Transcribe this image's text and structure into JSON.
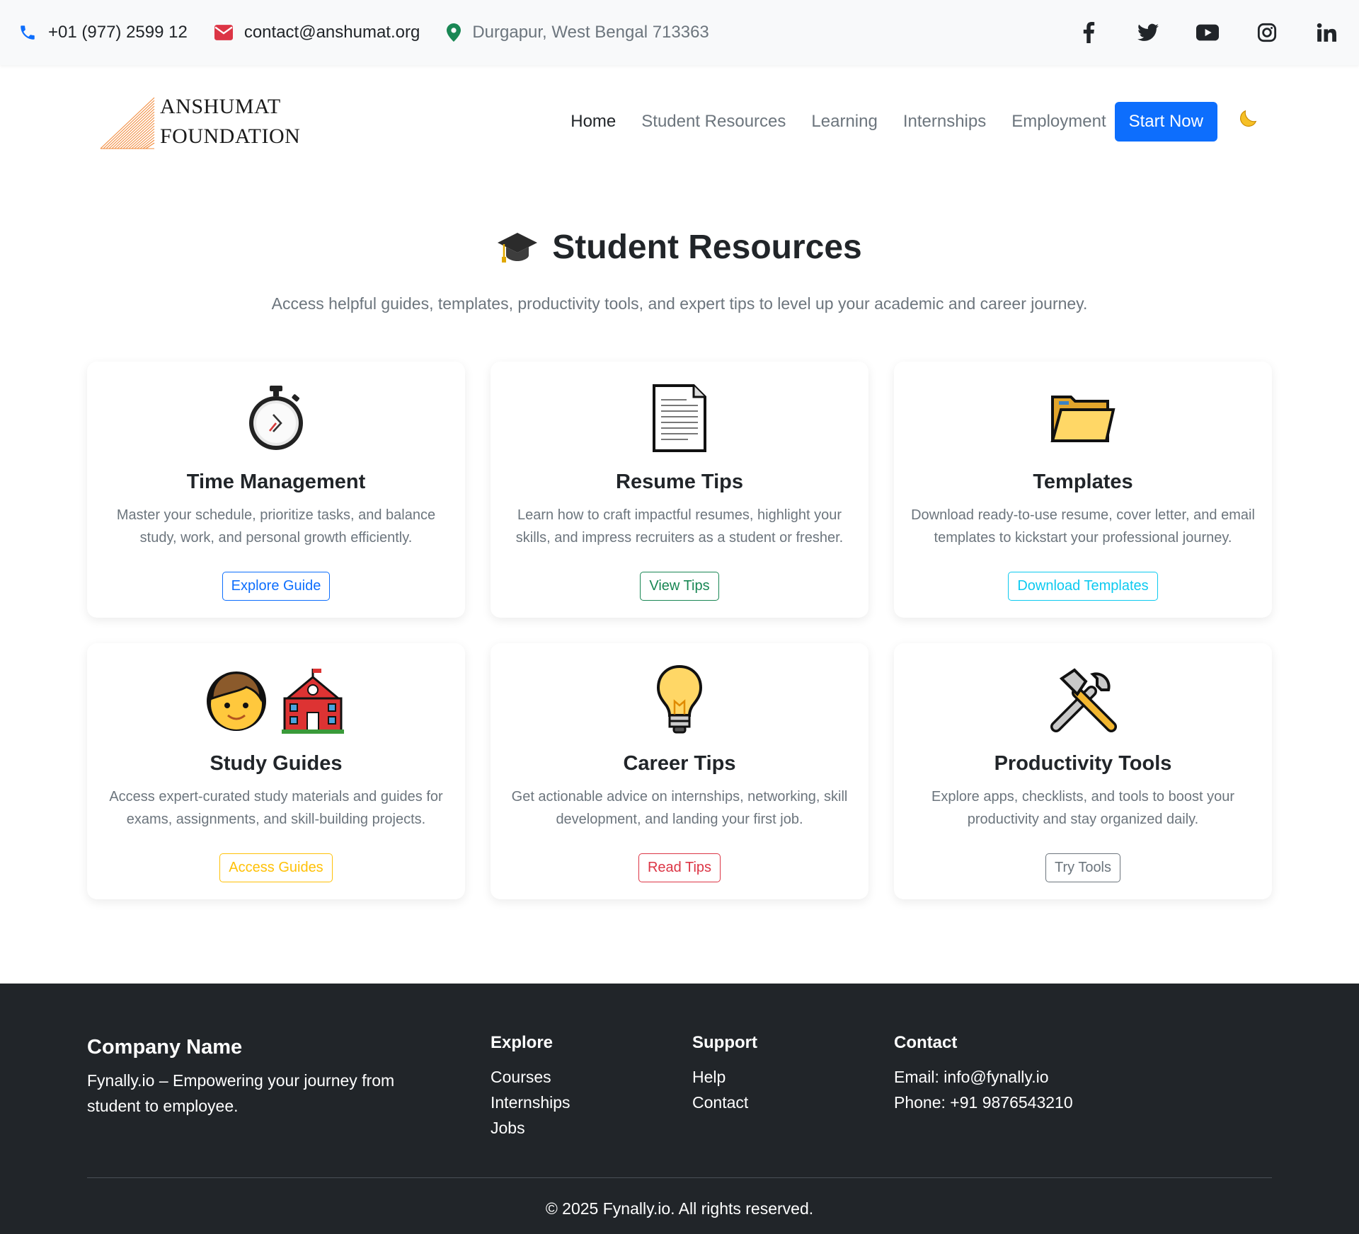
{
  "topbar": {
    "phone": "+01 (977) 2599 12",
    "email": "contact@anshumat.org",
    "location": "Durgapur, West Bengal 713363",
    "socials": [
      "facebook-icon",
      "twitter-icon",
      "youtube-icon",
      "instagram-icon",
      "linkedin-icon"
    ]
  },
  "logo": {
    "line1": "ANSHUMAT",
    "line2": "FOUNDATION"
  },
  "nav": {
    "items": [
      "Home",
      "Student Resources",
      "Learning",
      "Internships",
      "Employment"
    ],
    "cta": "Start Now",
    "theme_icon": "moon-icon"
  },
  "hero": {
    "title": "Student Resources",
    "subtitle": "Access helpful guides, templates, productivity tools, and expert tips to level up your academic and career journey."
  },
  "cards": [
    {
      "icon": "stopwatch-icon",
      "title": "Time Management",
      "text": "Master your schedule, prioritize tasks, and balance study, work, and personal growth efficiently.",
      "button": "Explore Guide"
    },
    {
      "icon": "document-icon",
      "title": "Resume Tips",
      "text": "Learn how to craft impactful resumes, highlight your skills, and impress recruiters as a student or fresher.",
      "button": "View Tips"
    },
    {
      "icon": "folder-icon",
      "title": "Templates",
      "text": "Download ready-to-use resume, cover letter, and email templates to kickstart your professional journey.",
      "button": "Download Templates"
    },
    {
      "icon": "student-school-icon",
      "title": "Study Guides",
      "text": "Access expert-curated study materials and guides for exams, assignments, and skill-building projects.",
      "button": "Access Guides"
    },
    {
      "icon": "lightbulb-icon",
      "title": "Career Tips",
      "text": "Get actionable advice on internships, networking, skill development, and landing your first job.",
      "button": "Read Tips"
    },
    {
      "icon": "tools-icon",
      "title": "Productivity Tools",
      "text": "Explore apps, checklists, and tools to boost your productivity and stay organized daily.",
      "button": "Try Tools"
    }
  ],
  "colors": {
    "primary": "#0d6efd",
    "footer_bg": "#212529"
  },
  "footer": {
    "company": "Company Name",
    "description": "Fynally.io – Empowering your journey from student to employee.",
    "explore": {
      "heading": "Explore",
      "links": [
        "Courses",
        "Internships",
        "Jobs"
      ]
    },
    "support": {
      "heading": "Support",
      "links": [
        "Help",
        "Contact"
      ]
    },
    "contact": {
      "heading": "Contact",
      "email": "Email: info@fynally.io",
      "phone": "Phone: +91 9876543210"
    },
    "copyright": "© 2025 Fynally.io. All rights reserved."
  }
}
